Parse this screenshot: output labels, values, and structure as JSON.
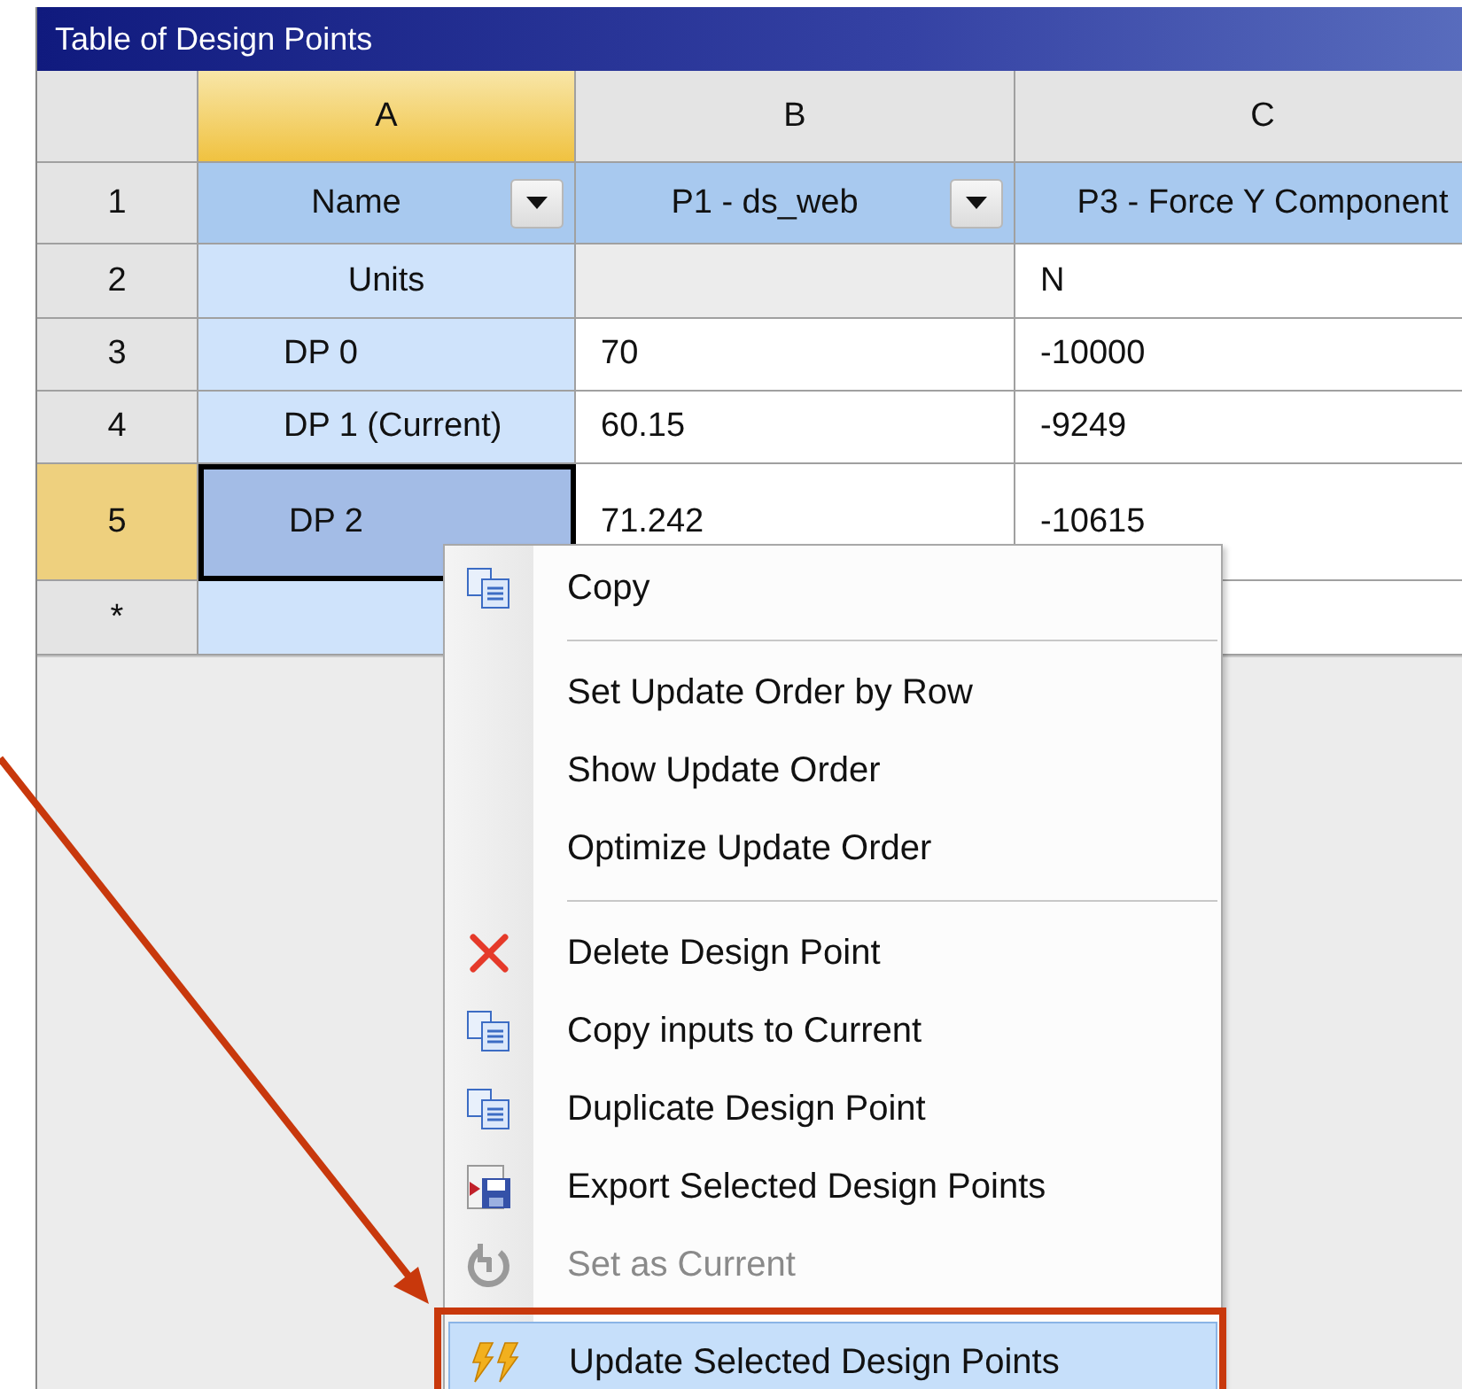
{
  "window": {
    "title": "Table of Design Points"
  },
  "columns": [
    {
      "label": "A",
      "selected": true
    },
    {
      "label": "B",
      "selected": false
    },
    {
      "label": "C",
      "selected": false
    }
  ],
  "rows": [
    {
      "header": "1",
      "selected": false,
      "cells": [
        {
          "kind": "heading",
          "text": "Name",
          "filter": true,
          "selected": false
        },
        {
          "kind": "heading",
          "text": "P1 - ds_web",
          "filter": true
        },
        {
          "kind": "heading",
          "text": "P3 - Force Y Component",
          "filter": false
        }
      ]
    },
    {
      "header": "2",
      "selected": false,
      "cells": [
        {
          "kind": "label",
          "text": "Units",
          "selected": false
        },
        {
          "kind": "blank"
        },
        {
          "kind": "value",
          "text": "N"
        }
      ]
    },
    {
      "header": "3",
      "selected": false,
      "cells": [
        {
          "kind": "name",
          "text": "DP 0",
          "selected": false
        },
        {
          "kind": "value",
          "text": "70"
        },
        {
          "kind": "value",
          "text": "-10000"
        }
      ]
    },
    {
      "header": "4",
      "selected": false,
      "cells": [
        {
          "kind": "name",
          "text": "DP 1 (Current)",
          "selected": false
        },
        {
          "kind": "value",
          "text": "60.15"
        },
        {
          "kind": "value",
          "text": "-9249"
        }
      ]
    },
    {
      "header": "5",
      "selected": true,
      "cells": [
        {
          "kind": "name",
          "text": "DP 2",
          "selected": true
        },
        {
          "kind": "value",
          "text": "71.242"
        },
        {
          "kind": "value",
          "text": "-10615"
        }
      ]
    },
    {
      "header": "*",
      "selected": false,
      "cells": [
        {
          "kind": "name",
          "selected": false
        }
      ]
    }
  ],
  "context_menu": [
    {
      "kind": "copy",
      "label": "Copy",
      "disabled": false,
      "selected": false
    },
    {
      "kind": "separator"
    },
    {
      "kind": "plain",
      "label": "Set Update Order by Row",
      "disabled": false,
      "selected": false
    },
    {
      "kind": "plain",
      "label": "Show Update Order",
      "disabled": false,
      "selected": false
    },
    {
      "kind": "plain",
      "label": "Optimize Update Order",
      "disabled": false,
      "selected": false
    },
    {
      "kind": "separator"
    },
    {
      "kind": "delete",
      "label": "Delete Design Point",
      "disabled": false,
      "selected": false
    },
    {
      "kind": "copy",
      "label": "Copy inputs to Current",
      "disabled": false,
      "selected": false
    },
    {
      "kind": "copy",
      "label": "Duplicate Design Point",
      "disabled": false,
      "selected": false
    },
    {
      "kind": "export",
      "label": "Export Selected Design Points",
      "disabled": false,
      "selected": false
    },
    {
      "kind": "current",
      "label": "Set as Current",
      "disabled": true,
      "selected": false
    },
    {
      "kind": "update",
      "label": "Update Selected Design Points",
      "disabled": false,
      "selected": true
    }
  ]
}
